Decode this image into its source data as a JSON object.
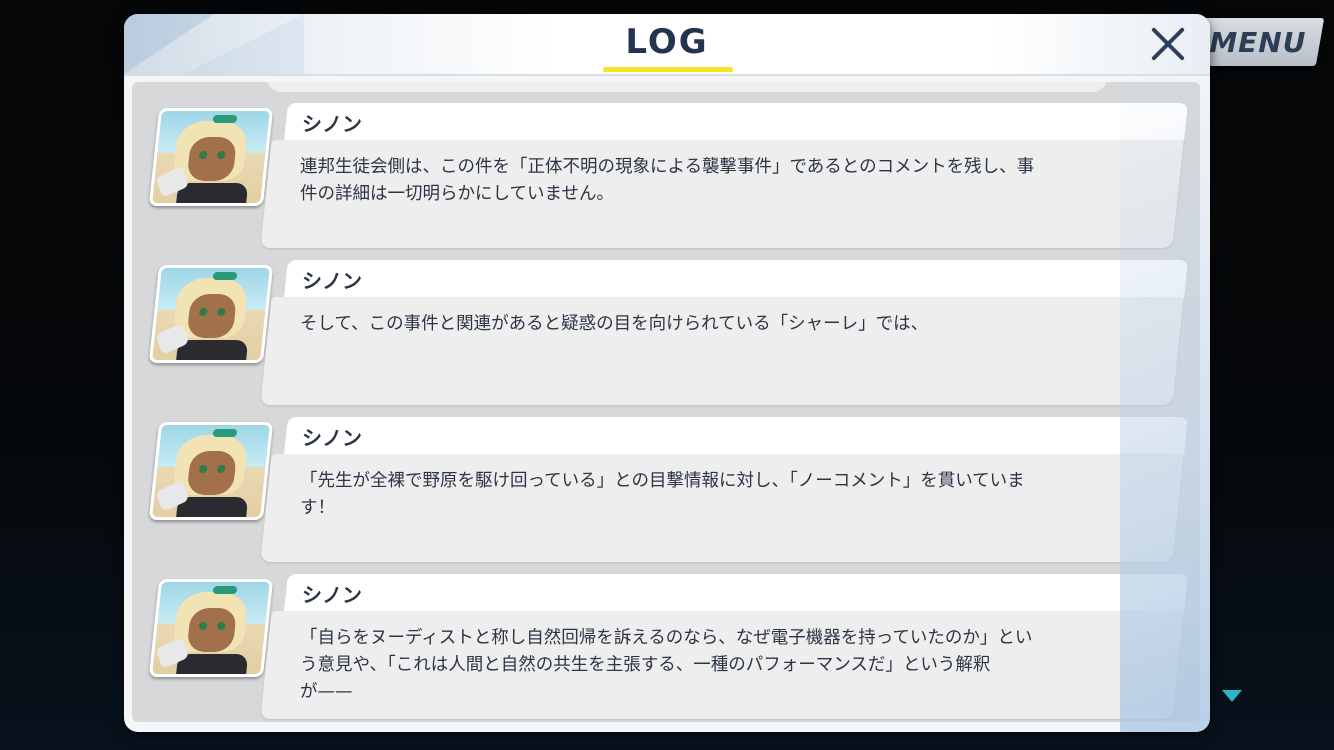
{
  "header": {
    "title": "LOG",
    "menu_label": "MENU"
  },
  "colors": {
    "title_text": "#24344f",
    "underline": "#f3e320",
    "scroll_arrow": "#27b6c8"
  },
  "log_entries": [
    {
      "speaker": "シノン",
      "text": "連邦生徒会側は、この件を「正体不明の現象による襲撃事件」であるとのコメントを残し、事\n件の詳細は一切明らかにしていません。"
    },
    {
      "speaker": "シノン",
      "text": "そして、この事件と関連があると疑惑の目を向けられている「シャーレ」では、"
    },
    {
      "speaker": "シノン",
      "text": "「先生が全裸で野原を駆け回っている」との目撃情報に対し、「ノーコメント」を貫いていま\nす！"
    },
    {
      "speaker": "シノン",
      "text": "「自らをヌーディストと称し自然回帰を訴えるのなら、なぜ電子機器を持っていたのか」とい\nう意見や、「これは人間と自然の共生を主張する、一種のパフォーマンスだ」という解釈\nが——"
    }
  ]
}
